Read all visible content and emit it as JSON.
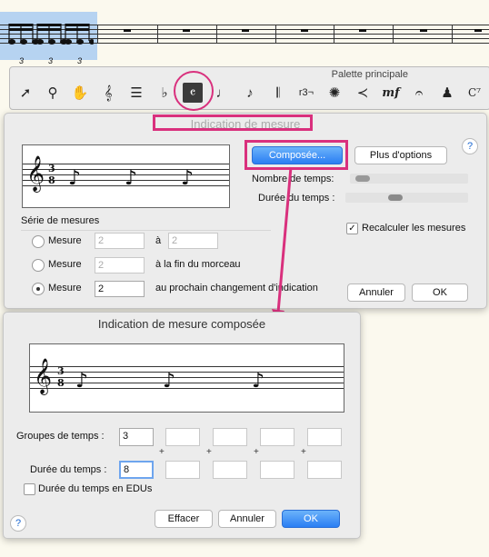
{
  "score": {
    "triplet_marks": [
      "3",
      "3",
      "3"
    ]
  },
  "palette": {
    "title": "Palette principale",
    "tools": [
      "arrow-icon",
      "zoom-icon",
      "hand-icon",
      "clef-icon",
      "key-signature-icon",
      "accidental-icon",
      "time-signature-icon",
      "note-icon",
      "grace-note-icon",
      "instrument-icon",
      "tuplet-icon",
      "articulation-icon",
      "hairpin-icon",
      "dynamics-icon",
      "repeat-icon",
      "expression-icon",
      "chord-icon"
    ],
    "tuplet_label": "r3¬",
    "dynamics_label": "mf",
    "chord_label": "C⁷"
  },
  "dialog1": {
    "title": "Indication de mesure",
    "composite_button": "Composée...",
    "more_options_button": "Plus d'options",
    "beats_label": "Nombre de temps:",
    "beat_duration_label": "Durée du temps :",
    "help": "?",
    "measure_range_label": "Série de mesures",
    "radio1_label": "Mesure",
    "radio1_value": "2",
    "radio1_to": "à",
    "radio1_to_value": "2",
    "radio2_label": "Mesure",
    "radio2_value": "2",
    "radio2_suffix": "à la fin du morceau",
    "radio3_label": "Mesure",
    "radio3_value": "2",
    "radio3_suffix": "au prochain changement d'indication",
    "recalc_label": "Recalculer les mesures",
    "recalc_checked": "✓",
    "cancel_button": "Annuler",
    "ok_button": "OK",
    "time_sig_top": "3",
    "time_sig_bottom": "8"
  },
  "dialog2": {
    "title": "Indication de mesure composée",
    "beat_groups_label": "Groupes de temps :",
    "beat_groups": [
      "3",
      "",
      "",
      "",
      ""
    ],
    "plus_signs": [
      "+",
      "+",
      "+",
      "+"
    ],
    "beat_duration_label": "Durée du temps :",
    "beat_durations": [
      "8",
      "",
      "",
      "",
      ""
    ],
    "edu_label": "Durée du temps en EDUs",
    "help": "?",
    "clear_button": "Effacer",
    "cancel_button": "Annuler",
    "ok_button": "OK",
    "time_sig_top": "3",
    "time_sig_bottom": "8"
  },
  "colors": {
    "highlight": "#d9307d",
    "selection": "#a9cdf1",
    "accent_button": "#2a7ef3"
  }
}
